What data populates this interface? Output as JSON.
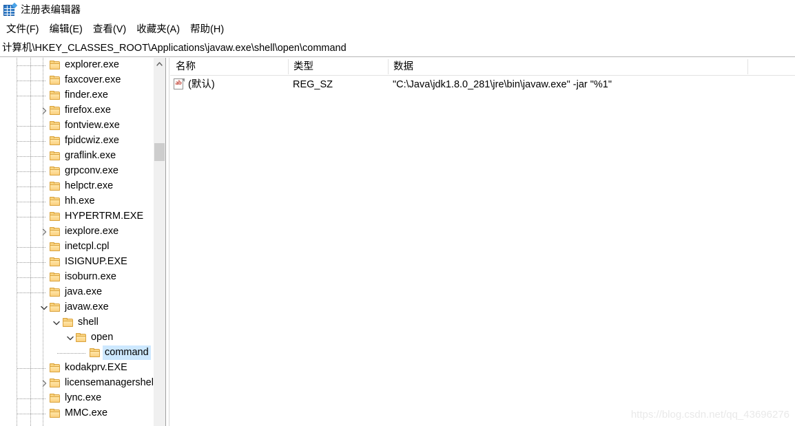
{
  "window": {
    "title": "注册表编辑器",
    "icon": "registry-editor-icon"
  },
  "menubar": {
    "items": [
      {
        "label": "文件(F)"
      },
      {
        "label": "编辑(E)"
      },
      {
        "label": "查看(V)"
      },
      {
        "label": "收藏夹(A)"
      },
      {
        "label": "帮助(H)"
      }
    ]
  },
  "address": {
    "path": "计算机\\HKEY_CLASSES_ROOT\\Applications\\javaw.exe\\shell\\open\\command"
  },
  "tree": {
    "items": [
      {
        "label": "explorer.exe",
        "indent": 1,
        "twisty": "none",
        "selected": false
      },
      {
        "label": "faxcover.exe",
        "indent": 1,
        "twisty": "none",
        "selected": false
      },
      {
        "label": "finder.exe",
        "indent": 1,
        "twisty": "none",
        "selected": false
      },
      {
        "label": "firefox.exe",
        "indent": 1,
        "twisty": "collapsed",
        "selected": false
      },
      {
        "label": "fontview.exe",
        "indent": 1,
        "twisty": "none",
        "selected": false
      },
      {
        "label": "fpidcwiz.exe",
        "indent": 1,
        "twisty": "none",
        "selected": false
      },
      {
        "label": "graflink.exe",
        "indent": 1,
        "twisty": "none",
        "selected": false
      },
      {
        "label": "grpconv.exe",
        "indent": 1,
        "twisty": "none",
        "selected": false
      },
      {
        "label": "helpctr.exe",
        "indent": 1,
        "twisty": "none",
        "selected": false
      },
      {
        "label": "hh.exe",
        "indent": 1,
        "twisty": "none",
        "selected": false
      },
      {
        "label": "HYPERTRM.EXE",
        "indent": 1,
        "twisty": "none",
        "selected": false
      },
      {
        "label": "iexplore.exe",
        "indent": 1,
        "twisty": "collapsed",
        "selected": false
      },
      {
        "label": "inetcpl.cpl",
        "indent": 1,
        "twisty": "none",
        "selected": false
      },
      {
        "label": "ISIGNUP.EXE",
        "indent": 1,
        "twisty": "none",
        "selected": false
      },
      {
        "label": "isoburn.exe",
        "indent": 1,
        "twisty": "none",
        "selected": false
      },
      {
        "label": "java.exe",
        "indent": 1,
        "twisty": "none",
        "selected": false
      },
      {
        "label": "javaw.exe",
        "indent": 1,
        "twisty": "expanded",
        "selected": false
      },
      {
        "label": "shell",
        "indent": 2,
        "twisty": "expanded",
        "selected": false
      },
      {
        "label": "open",
        "indent": 3,
        "twisty": "expanded",
        "selected": false
      },
      {
        "label": "command",
        "indent": 4,
        "twisty": "none",
        "selected": true
      },
      {
        "label": "kodakprv.EXE",
        "indent": 1,
        "twisty": "none",
        "selected": false
      },
      {
        "label": "licensemanagershel",
        "indent": 1,
        "twisty": "collapsed",
        "selected": false
      },
      {
        "label": "lync.exe",
        "indent": 1,
        "twisty": "none",
        "selected": false
      },
      {
        "label": "MMC.exe",
        "indent": 1,
        "twisty": "none",
        "selected": false
      }
    ],
    "scrollbar": {
      "up_arrow": "chevron-up-icon"
    }
  },
  "list": {
    "columns": [
      {
        "label": "名称"
      },
      {
        "label": "类型"
      },
      {
        "label": "数据"
      }
    ],
    "rows": [
      {
        "icon": "string-value-icon",
        "name": "(默认)",
        "type": "REG_SZ",
        "data": "\"C:\\Java\\jdk1.8.0_281\\jre\\bin\\javaw.exe\" -jar \"%1\""
      }
    ]
  },
  "watermark": {
    "text": "https://blog.csdn.net/qq_43696276"
  },
  "colors": {
    "selection": "#cde8ff",
    "folder": "#fcd88a",
    "accent": "#2f79c4",
    "value_icon_text": "#c0392b"
  }
}
